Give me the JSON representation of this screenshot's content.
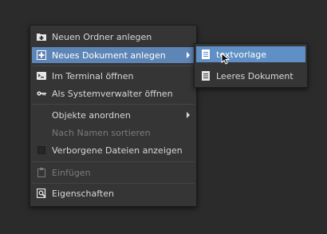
{
  "context_menu": {
    "items": [
      {
        "label": "Neuen Ordner anlegen",
        "icon": "folder-new-icon"
      },
      {
        "label": "Neues Dokument anlegen",
        "icon": "document-new-icon",
        "highlighted": true,
        "submenu": true
      },
      {
        "label": "Im Terminal öffnen",
        "icon": "terminal-icon"
      },
      {
        "label": "Als Systemverwalter öffnen",
        "icon": "key-icon"
      },
      {
        "label": "Objekte anordnen",
        "submenu": true
      },
      {
        "label": "Nach Namen sortieren",
        "disabled": true
      },
      {
        "label": "Verborgene Dateien anzeigen",
        "checkbox": true,
        "checked": false
      },
      {
        "label": "Einfügen",
        "icon": "clipboard-icon",
        "disabled": true
      },
      {
        "label": "Eigenschaften",
        "icon": "properties-icon"
      }
    ]
  },
  "submenu": {
    "items": [
      {
        "label": "textvorlage",
        "icon": "text-document-icon",
        "highlighted": true
      },
      {
        "label": "Leeres Dokument",
        "icon": "text-document-icon"
      }
    ]
  },
  "colors": {
    "menu_bg": "#353535",
    "highlight": "#5d85b6",
    "text": "#d8d8d8",
    "disabled_text": "#7b7b7b",
    "desktop_bg": "#2b2b2b"
  }
}
